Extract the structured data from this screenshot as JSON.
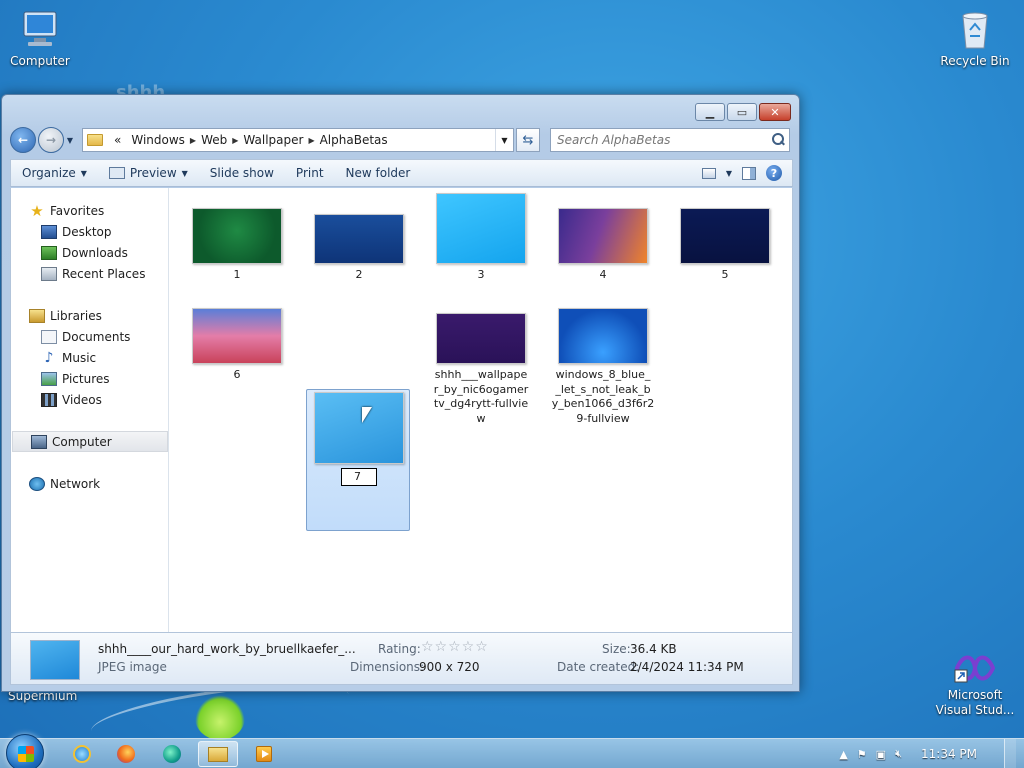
{
  "desktop": {
    "icons": [
      {
        "label": "Computer"
      },
      {
        "label": "Recycle Bin"
      },
      {
        "label": "Supermium"
      },
      {
        "label": "Microsoft Visual Stud..."
      }
    ],
    "ghost_text": "shhh"
  },
  "window": {
    "breadcrumb": [
      "Windows",
      "Web",
      "Wallpaper",
      "AlphaBetas"
    ],
    "breadcrumb_overflow": "«",
    "search_placeholder": "Search AlphaBetas",
    "toolbar": {
      "organize": "Organize",
      "preview": "Preview",
      "slideshow": "Slide show",
      "print": "Print",
      "new_folder": "New folder"
    },
    "nav": {
      "favorites": "Favorites",
      "desktop": "Desktop",
      "downloads": "Downloads",
      "recent": "Recent Places",
      "libraries": "Libraries",
      "documents": "Documents",
      "music": "Music",
      "pictures": "Pictures",
      "videos": "Videos",
      "computer": "Computer",
      "network": "Network"
    },
    "files": [
      {
        "name": "1"
      },
      {
        "name": "2"
      },
      {
        "name": "3"
      },
      {
        "name": "4"
      },
      {
        "name": "5"
      },
      {
        "name": "6"
      },
      {
        "name": "7",
        "renaming": true
      },
      {
        "name": "shhh___wallpaper_by_nic6ogamertv_dg4rytt-fullview",
        "lines": [
          "shhh___wallpape",
          "r_by_nic6ogamer",
          "tv_dg4rytt-fullvie",
          "w"
        ]
      },
      {
        "name": "windows_8_blue__let_s_not_leak_by_ben1066_d3f6r29-fullview",
        "lines": [
          "windows_8_blue_",
          "_let_s_not_leak_b",
          "y_ben1066_d3f6r2",
          "9-fullview"
        ]
      }
    ],
    "details": {
      "filename": "shhh____our_hard_work_by_bruellkaefer_...",
      "type": "JPEG image",
      "rating_label": "Rating:",
      "stars": "☆☆☆☆☆",
      "dimensions_label": "Dimensions:",
      "dimensions": "900 x 720",
      "size_label": "Size:",
      "size": "36.4 KB",
      "date_label": "Date created:",
      "date": "2/4/2024 11:34 PM"
    }
  },
  "taskbar": {
    "clock": "11:34 PM"
  },
  "colors": {
    "desktop": "#2a8ad0",
    "selection": "#c1dcfa",
    "close": "#c6402b"
  }
}
